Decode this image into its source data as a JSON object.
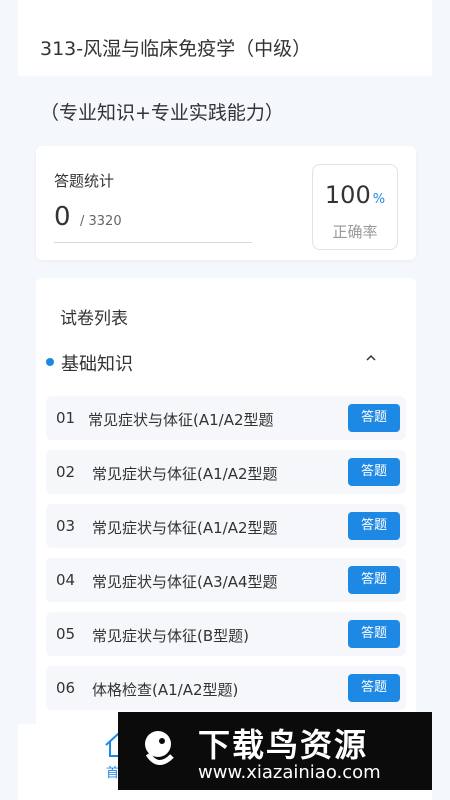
{
  "header": {
    "title": "313-风湿与临床免疫学（中级）"
  },
  "subtitle": "（专业知识+专业实践能力）",
  "stats": {
    "label": "答题统计",
    "answered": "0",
    "total": "/ 3320",
    "accuracy_value": "100",
    "accuracy_symbol": "%",
    "accuracy_label": "正确率"
  },
  "paper_list": {
    "title": "试卷列表",
    "section": "基础知识",
    "items": [
      {
        "num": "01",
        "label": "常见症状与体征(A1/A2型题",
        "button": "答题"
      },
      {
        "num": "02",
        "label": "常见症状与体征(A1/A2型题",
        "button": "答题"
      },
      {
        "num": "03",
        "label": "常见症状与体征(A1/A2型题",
        "button": "答题"
      },
      {
        "num": "04",
        "label": "常见症状与体征(A3/A4型题",
        "button": "答题"
      },
      {
        "num": "05",
        "label": "常见症状与体征(B型题)",
        "button": "答题"
      },
      {
        "num": "06",
        "label": "体格检查(A1/A2型题)",
        "button": "答题"
      }
    ]
  },
  "bottom_nav": {
    "home_label": "首"
  },
  "watermark": {
    "title": "下载鸟资源",
    "url": "www.xiazainiao.com"
  },
  "colors": {
    "accent": "#1e88e5",
    "background": "#f4f7fc"
  }
}
